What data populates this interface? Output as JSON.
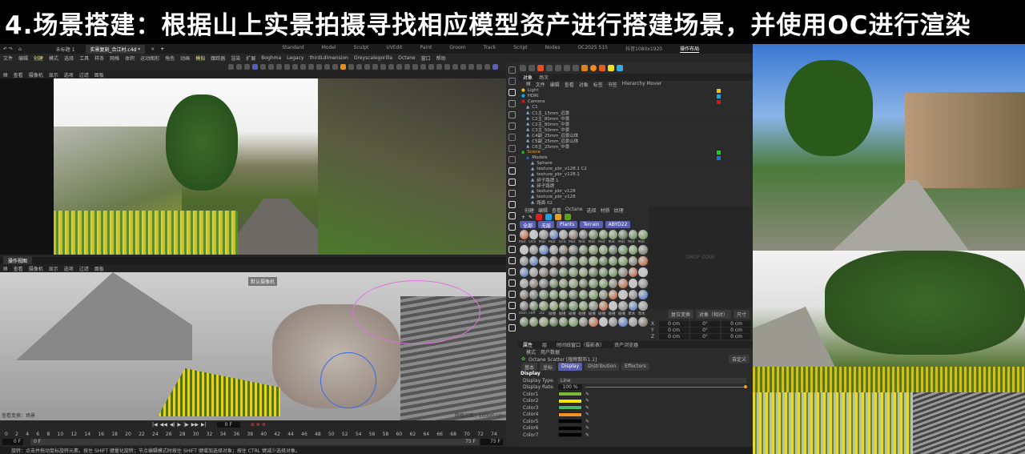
{
  "title": "4.场景搭建：根据山上实景拍摄寻找相应模型资产进行搭建场景，并使用OC进行渲染",
  "tabs": [
    "未标题 1",
    "实景复刻_合江村.c4d *"
  ],
  "layouts": [
    "Standard",
    "Model",
    "Sculpt",
    "UVEdit",
    "Paint",
    "Groom",
    "Track",
    "Script",
    "Nodes",
    "OC2025 515",
    "抖音1080x1920",
    "操作布局"
  ],
  "menu": [
    "文件",
    "编辑",
    "创建",
    "模式",
    "选择",
    "工具",
    "样条",
    "网格",
    "体积",
    "运动图形",
    "角色",
    "动画",
    "模拟",
    "跟踪器",
    "渲染",
    "扩展",
    "Boghma",
    "Legacy",
    "thirdLdimension",
    "Greyscalegorilla",
    "Octane",
    "窗口",
    "帮助"
  ],
  "viewport_menu": [
    "查看",
    "摄像机",
    "显示",
    "选项",
    "过滤",
    "面板"
  ],
  "viewport2": {
    "tab": "操作视图",
    "camera_label": "默认摄像机",
    "grid_label": "网格间距：10000 cm",
    "tag": "查看变换：场景"
  },
  "object_manager": {
    "tabs": [
      "对象",
      "场次"
    ],
    "menu": [
      "文件",
      "编辑",
      "查看",
      "对象",
      "标签",
      "书签",
      "Hierarchy Mover"
    ],
    "objects": [
      {
        "name": "Light",
        "color": "#f5c400",
        "indent": 0
      },
      {
        "name": "HDRI",
        "color": "#16a6e8",
        "indent": 0
      },
      {
        "name": "Camera",
        "color": "#e01010",
        "indent": 0
      },
      {
        "name": "C1",
        "indent": 1
      },
      {
        "name": "C1主_15mm_远景",
        "indent": 1
      },
      {
        "name": "C2主_80mm_中景",
        "indent": 1
      },
      {
        "name": "C2主_80mm_中景",
        "indent": 1
      },
      {
        "name": "C3主_50mm_中景",
        "indent": 1
      },
      {
        "name": "C4副_25mm_远景山体",
        "indent": 1
      },
      {
        "name": "C5副_25mm_远景山体",
        "indent": 1
      },
      {
        "name": "C6主_25mm_中景",
        "indent": 1
      },
      {
        "name": "Scene",
        "color": "#18d018",
        "indent": 0
      },
      {
        "name": "Models",
        "color": "#1a6ee8",
        "indent": 1
      },
      {
        "name": "Sphere",
        "indent": 2
      },
      {
        "name": "texture_pbr_v128.1 C2",
        "indent": 2
      },
      {
        "name": "texture_pbr_v128.1",
        "indent": 2
      },
      {
        "name": "碎子路牌.1",
        "indent": 2
      },
      {
        "name": "碎子路牌",
        "indent": 2
      },
      {
        "name": "texture_pbr_v128",
        "indent": 2
      },
      {
        "name": "texture_pbr_v128",
        "indent": 2
      },
      {
        "name": "路面 02",
        "indent": 2
      }
    ]
  },
  "material_manager": {
    "menu": [
      "创建",
      "编辑",
      "查看",
      "Octane",
      "选择",
      "材质",
      "纹理"
    ],
    "filters": [
      "全部",
      "无层",
      "Plants",
      "Terrain",
      "ABYD22"
    ],
    "labels_row1": [
      "Mat",
      "Octl",
      "Mat",
      "Mat",
      "Octl",
      "Mat",
      "Mat",
      "Mat",
      "Mat",
      "Mat",
      "Mat",
      "Mat",
      "Mat",
      "Mat"
    ],
    "labels_row2": [
      "ston",
      "cliff",
      "1t2",
      "碰撞",
      "碰撞",
      "碰撞",
      "碰撞",
      "碰撞",
      "碰撞",
      "碰撞",
      "碰撞",
      "草木",
      "草木",
      "草木"
    ],
    "drop_zone": "DROP ZONE"
  },
  "coords": {
    "headers": [
      "复位变换",
      "对象（相对）",
      "尺寸"
    ],
    "rows": [
      {
        "axis": "X",
        "p": "0 cm",
        "r": "0°",
        "s": "0 cm"
      },
      {
        "axis": "Y",
        "p": "0 cm",
        "r": "0°",
        "s": "0 cm"
      },
      {
        "axis": "Z",
        "p": "0 cm",
        "r": "0°",
        "s": "0 cm"
      }
    ]
  },
  "attributes": {
    "tabs": [
      "属性",
      "层",
      "时间线窗口（摄影表）",
      "资产浏览器"
    ],
    "menu": [
      "模式",
      "用户数据"
    ],
    "object": "Octane Scatter [植物散布1.1]",
    "preset": "自定义",
    "subtabs": [
      "基本",
      "坐标",
      "Display",
      "Distribution",
      "Effectors"
    ],
    "section": "Display",
    "display_type_label": "Display Type",
    "display_type": "Line",
    "display_rate_label": "Display Rate",
    "display_rate": "100 %",
    "display_rate_value": 1.0,
    "colors": [
      {
        "label": "Color1",
        "hex": "#7db83a"
      },
      {
        "label": "Color2",
        "hex": "#f7e600"
      },
      {
        "label": "Color3",
        "hex": "#4db86c"
      },
      {
        "label": "Color4",
        "hex": "#f5922a"
      },
      {
        "label": "Color5",
        "hex": "#000000"
      },
      {
        "label": "Color6",
        "hex": "#000000"
      },
      {
        "label": "Color7",
        "hex": "#000000"
      }
    ]
  },
  "timeline": {
    "current": "0 F",
    "start": "0 F",
    "range_start": "0 F",
    "range_end": "75 F",
    "end": "75 F",
    "ticks": [
      "0",
      "2",
      "4",
      "6",
      "8",
      "10",
      "12",
      "14",
      "16",
      "18",
      "20",
      "22",
      "24",
      "26",
      "28",
      "30",
      "32",
      "34",
      "36",
      "38",
      "40",
      "42",
      "44",
      "46",
      "48",
      "50",
      "52",
      "54",
      "56",
      "58",
      "60",
      "62",
      "64",
      "66",
      "68",
      "70",
      "72",
      "74"
    ]
  },
  "status": "旋转：点击并拖动鼠标旋转元素。按住 SHIFT 键量化旋转；节点编辑模式时按住 SHIFT 键增加选择对象；按住 CTRL 键减少选择对象。"
}
